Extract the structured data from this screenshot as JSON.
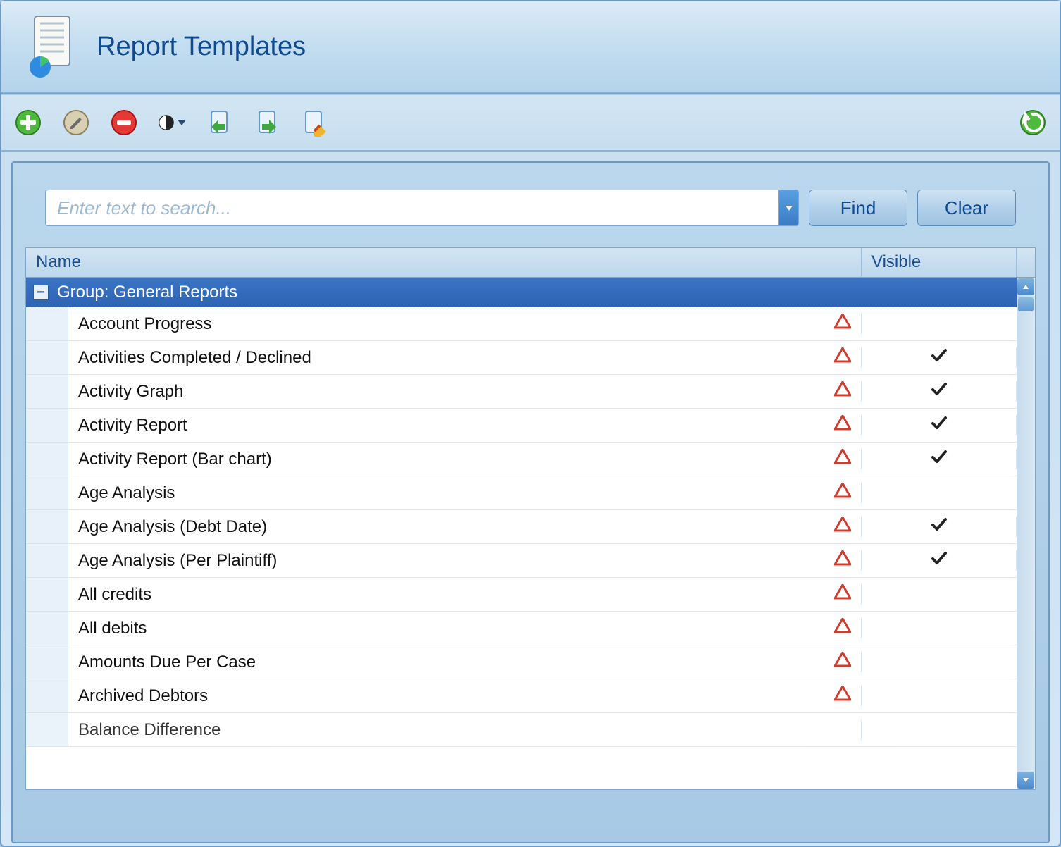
{
  "title": "Report Templates",
  "search": {
    "placeholder": "Enter text to search...",
    "find_label": "Find",
    "clear_label": "Clear"
  },
  "columns": {
    "name": "Name",
    "visible": "Visible"
  },
  "group": {
    "label": "Group: General Reports",
    "expanded": true
  },
  "rows": [
    {
      "name": "Account Progress",
      "warn": true,
      "visible": false
    },
    {
      "name": "Activities Completed / Declined",
      "warn": true,
      "visible": true
    },
    {
      "name": "Activity Graph",
      "warn": true,
      "visible": true
    },
    {
      "name": "Activity Report",
      "warn": true,
      "visible": true
    },
    {
      "name": "Activity Report (Bar chart)",
      "warn": true,
      "visible": true
    },
    {
      "name": "Age Analysis",
      "warn": true,
      "visible": false
    },
    {
      "name": "Age Analysis (Debt Date)",
      "warn": true,
      "visible": true
    },
    {
      "name": "Age Analysis (Per Plaintiff)",
      "warn": true,
      "visible": true
    },
    {
      "name": "All credits",
      "warn": true,
      "visible": false
    },
    {
      "name": "All debits",
      "warn": true,
      "visible": false
    },
    {
      "name": "Amounts Due Per Case",
      "warn": true,
      "visible": false
    },
    {
      "name": "Archived Debtors",
      "warn": true,
      "visible": false
    },
    {
      "name": "Balance Difference",
      "warn": false,
      "visible": false
    }
  ],
  "toolbar": {
    "add": "add-icon",
    "edit": "edit-icon",
    "delete": "delete-icon",
    "visibility": "visibility-icon",
    "import": "import-icon",
    "export": "export-icon",
    "apply": "apply-icon",
    "refresh": "refresh-icon"
  }
}
